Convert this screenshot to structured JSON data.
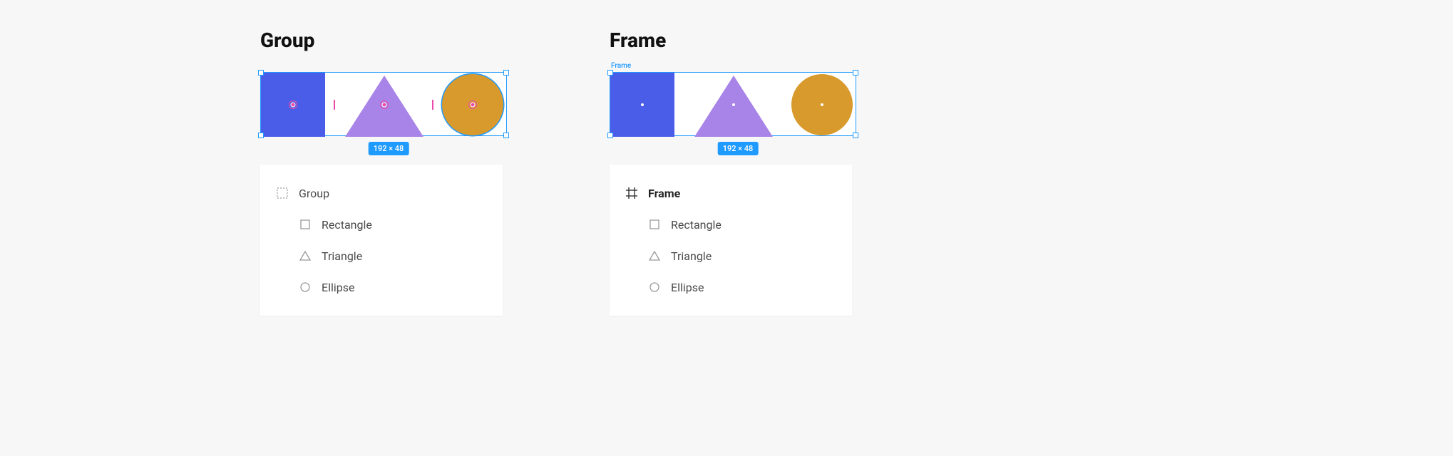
{
  "sections": {
    "group": {
      "heading": "Group",
      "dimensions": "192 × 48",
      "layers": {
        "parent": "Group",
        "children": [
          "Rectangle",
          "Triangle",
          "Ellipse"
        ]
      }
    },
    "frame": {
      "heading": "Frame",
      "frame_label": "Frame",
      "dimensions": "192 × 48",
      "layers": {
        "parent": "Frame",
        "children": [
          "Rectangle",
          "Triangle",
          "Ellipse"
        ]
      }
    }
  },
  "colors": {
    "rectangle": "#4a5de8",
    "triangle": "#a883e8",
    "ellipse": "#d89a2c",
    "selection": "#1f9aff",
    "origin_marker": "#e94ca8"
  }
}
